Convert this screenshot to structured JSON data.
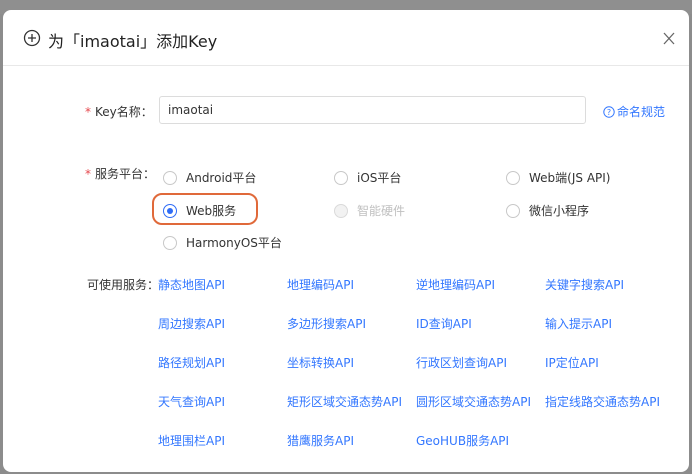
{
  "dialog": {
    "title": "为「imaotai」添加Key",
    "close_glyph": "×"
  },
  "form": {
    "key_name_label": "Key名称：",
    "key_name_value": "imaotai",
    "required_mark": "*",
    "help_link": "命名规范",
    "platform_label": "服务平台：",
    "platforms": [
      {
        "label": "Android平台",
        "checked": false,
        "disabled": false
      },
      {
        "label": "iOS平台",
        "checked": false,
        "disabled": false
      },
      {
        "label": "Web端(JS API)",
        "checked": false,
        "disabled": false
      },
      {
        "label": "Web服务",
        "checked": true,
        "disabled": false
      },
      {
        "label": "智能硬件",
        "checked": false,
        "disabled": true
      },
      {
        "label": "微信小程序",
        "checked": false,
        "disabled": false
      },
      {
        "label": "HarmonyOS平台",
        "checked": false,
        "disabled": false
      }
    ],
    "services_label": "可使用服务：",
    "services": [
      "静态地图API",
      "地理编码API",
      "逆地理编码API",
      "关键字搜索API",
      "周边搜索API",
      "多边形搜索API",
      "ID查询API",
      "输入提示API",
      "路径规划API",
      "坐标转换API",
      "行政区划查询API",
      "IP定位API",
      "天气查询API",
      "矩形区域交通态势API",
      "圆形区域交通态势API",
      "指定线路交通态势API",
      "地理围栏API",
      "猎鹰服务API",
      "GeoHUB服务API"
    ]
  },
  "colors": {
    "accent": "#2f6cf6",
    "link": "#3377ff",
    "highlight_ring": "#e0693a",
    "required": "#e5484d"
  },
  "icons": [
    "plus-circle-icon",
    "close-icon",
    "help-circle-icon"
  ]
}
